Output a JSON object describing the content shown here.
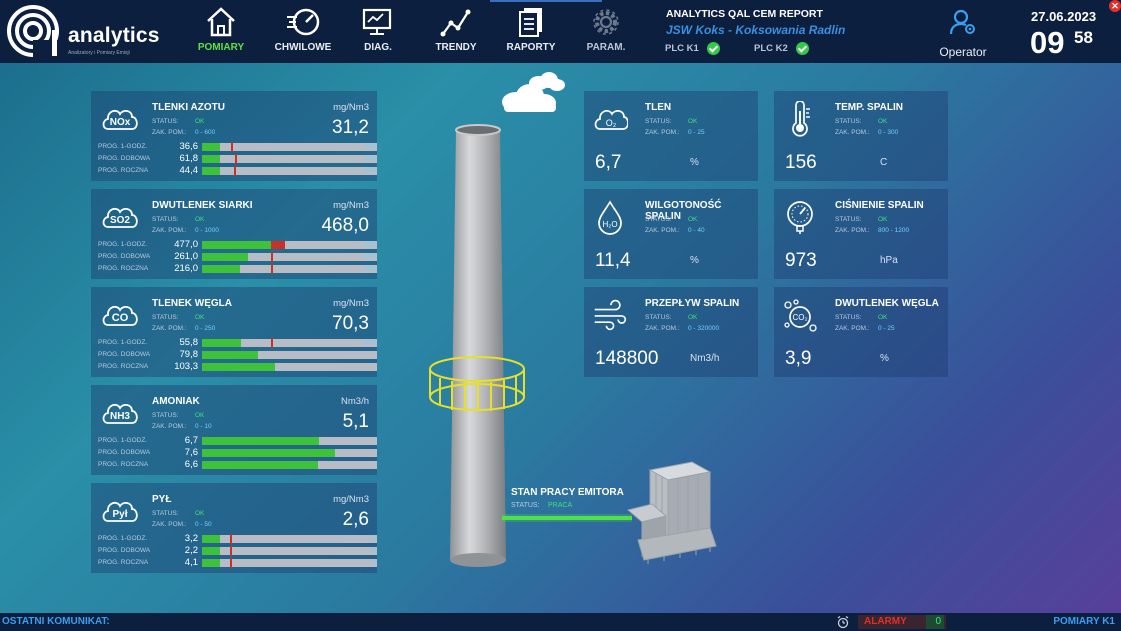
{
  "app": {
    "brand": "analytics",
    "tagline": "Analizatory i Pomiary Emisji",
    "report_title": "ANALYTICS QAL CEM REPORT",
    "site": "JSW Koks - Koksowania Radlin",
    "plc": [
      {
        "label": "PLC K1",
        "status": "ok"
      },
      {
        "label": "PLC K2",
        "status": "ok"
      }
    ],
    "operator": "Operator",
    "date": "27.06.2023",
    "hour": "09",
    "minute": "58"
  },
  "nav": [
    {
      "label": "POMIARY",
      "icon": "home-icon",
      "active": true
    },
    {
      "label": "CHWILOWE",
      "icon": "speedometer-icon",
      "active": false
    },
    {
      "label": "DIAG.",
      "icon": "monitor-diagnostics-icon",
      "active": false
    },
    {
      "label": "TRENDY",
      "icon": "trend-line-icon",
      "active": false
    },
    {
      "label": "RAPORTY",
      "icon": "report-document-icon",
      "active": false
    },
    {
      "label": "PARAM.",
      "icon": "gear-icon",
      "active": false,
      "disabled": true
    }
  ],
  "labels": {
    "status": "STATUS:",
    "range": "ZAK. POM.:",
    "prog_1h": "PROG. 1-GODZ.",
    "prog_day": "PROG. DOBOWA",
    "prog_year": "PROG. ROCZNA"
  },
  "gases": [
    {
      "name": "TLENKI AZOTU",
      "icon_text": "NOx",
      "unit": "mg/Nm3",
      "value": "31,2",
      "status": "OK",
      "range": "0 - 600",
      "rows": [
        {
          "value": "36,6",
          "fill": 0.1,
          "over": 0,
          "mark": 0.165,
          "limit": "100"
        },
        {
          "value": "61,8",
          "fill": 0.1,
          "over": 0,
          "mark": 0.19,
          "limit": "110"
        },
        {
          "value": "44,4",
          "fill": 0.1,
          "over": 0,
          "mark": 0.185,
          "limit": "110"
        }
      ]
    },
    {
      "name": "DWUTLENEK SIARKI",
      "icon_text": "SO2",
      "unit": "mg/Nm3",
      "value": "468,0",
      "status": "OK",
      "range": "0 - 1000",
      "rows": [
        {
          "value": "477,0",
          "fill": 0.395,
          "over": 0.08,
          "mark": -1,
          "limit": "400"
        },
        {
          "value": "261,0",
          "fill": 0.26,
          "over": 0,
          "mark": 0.395,
          "limit": "400"
        },
        {
          "value": "216,0",
          "fill": 0.215,
          "over": 0,
          "mark": 0.395,
          "limit": "400"
        }
      ]
    },
    {
      "name": "TLENEK WĘGLA",
      "icon_text": "CO",
      "unit": "mg/Nm3",
      "value": "70,3",
      "status": "OK",
      "range": "0 - 250",
      "rows": [
        {
          "value": "55,8",
          "fill": 0.225,
          "over": 0,
          "mark": 0.395,
          "limit": "100"
        },
        {
          "value": "79,8",
          "fill": 0.32,
          "over": 0,
          "mark": -1,
          "limit": ""
        },
        {
          "value": "103,3",
          "fill": 0.415,
          "over": 0,
          "mark": -1,
          "limit": ""
        }
      ]
    },
    {
      "name": "AMONIAK",
      "icon_text": "NH3",
      "unit": "Nm3/h",
      "value": "5,1",
      "status": "OK",
      "range": "0 - 10",
      "rows": [
        {
          "value": "6,7",
          "fill": 0.67,
          "over": 0,
          "mark": -1,
          "limit": ""
        },
        {
          "value": "7,6",
          "fill": 0.76,
          "over": 0,
          "mark": -1,
          "limit": ""
        },
        {
          "value": "6,6",
          "fill": 0.66,
          "over": 0,
          "mark": -1,
          "limit": ""
        }
      ]
    },
    {
      "name": "PYŁ",
      "icon_text": "Pył",
      "unit": "mg/Nm3",
      "value": "2,6",
      "status": "OK",
      "range": "0 - 50",
      "rows": [
        {
          "value": "3,2",
          "fill": 0.1,
          "over": 0,
          "mark": 0.16,
          "limit": "5"
        },
        {
          "value": "2,2",
          "fill": 0.1,
          "over": 0,
          "mark": 0.16,
          "limit": "5"
        },
        {
          "value": "4,1",
          "fill": 0.1,
          "over": 0,
          "mark": 0.16,
          "limit": "5"
        }
      ]
    }
  ],
  "params": [
    {
      "name": "TLEN",
      "icon": "oxygen-cloud-icon",
      "status": "OK",
      "range": "0 - 25",
      "value": "6,7",
      "unit": "%"
    },
    {
      "name": "TEMP. SPALIN",
      "icon": "thermometer-icon",
      "status": "OK",
      "range": "0 - 300",
      "value": "156",
      "unit": "C"
    },
    {
      "name": "WILGOTONOŚĆ SPALIN",
      "icon": "water-drop-icon",
      "status": "OK",
      "range": "0 - 40",
      "value": "11,4",
      "unit": "%"
    },
    {
      "name": "CIŚNIENIE SPALIN",
      "icon": "pressure-gauge-icon",
      "status": "OK",
      "range": "800 - 1200",
      "value": "973",
      "unit": "hPa"
    },
    {
      "name": "PRZEPŁYW SPALIN",
      "icon": "wind-icon",
      "status": "OK",
      "range": "0 - 320000",
      "value": "148800",
      "unit": "Nm3/h"
    },
    {
      "name": "DWUTLENEK WĘGLA",
      "icon": "co2-bubbles-icon",
      "status": "OK",
      "range": "0 - 25",
      "value": "3,9",
      "unit": "%"
    }
  ],
  "emitter": {
    "title": "STAN PRACY EMITORA",
    "status_label": "STATUS:",
    "status_value": "PRACA"
  },
  "footer": {
    "last_message": "OSTATNI KOMUNIKAT:",
    "alarms_label": "ALARMY",
    "alarms_count": "0",
    "mode": "POMIARY K1"
  },
  "colors": {
    "accent_green": "#3ec23a",
    "alarm_red": "#c8302a",
    "header_bg": "#0d1f3e",
    "panel_bg": "rgba(28,58,110,0.42)",
    "cyan_text": "#6fd0ff"
  }
}
